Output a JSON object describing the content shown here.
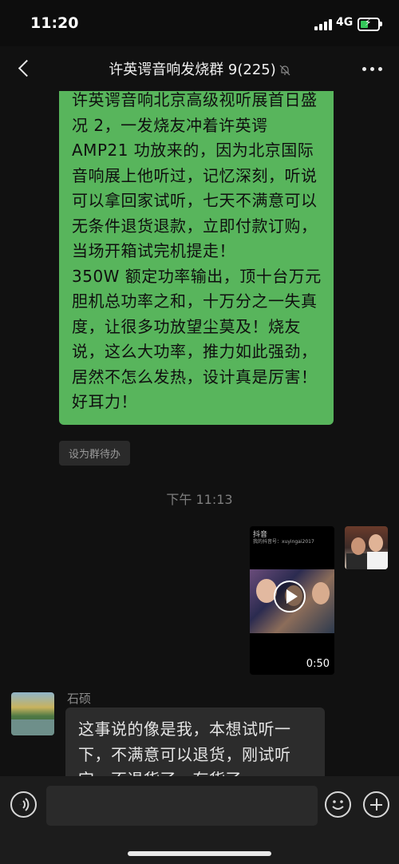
{
  "status_bar": {
    "time": "11:20",
    "network": "4G"
  },
  "header": {
    "title": "许英谔音响发烧群 9(225)",
    "muted": true
  },
  "messages": {
    "outgoing_text": "许英谔音响北京高级视听展首日盛况 2，一发烧友冲着许英谔 AMP21 功放来的，因为北京国际音响展上他听过，记忆深刻，听说可以拿回家试听，七天不满意可以无条件退货退款，立即付款订购，当场开箱试完机提走！\n350W 额定功率输出，顶十台万元胆机总功率之和，十万分之一失真度，让很多功放望尘莫及！烧友说，这么大功率，推力如此强劲，居然不怎么发热，设计真是厉害！好耳力！",
    "todo_label": "设为群待办",
    "timestamp": "下午 11:13",
    "video": {
      "logo": "抖音",
      "account_id": "我的抖音号：xuyingai2017",
      "duration": "0:50"
    },
    "incoming": {
      "sender": "石硕",
      "text": "这事说的像是我，本想试听一下，不满意可以退货，刚试听完，不退货了，存货了"
    }
  },
  "colors": {
    "outgoing_bubble": "#58b55c",
    "incoming_bubble": "#2c2c2c",
    "background": "#111111"
  }
}
